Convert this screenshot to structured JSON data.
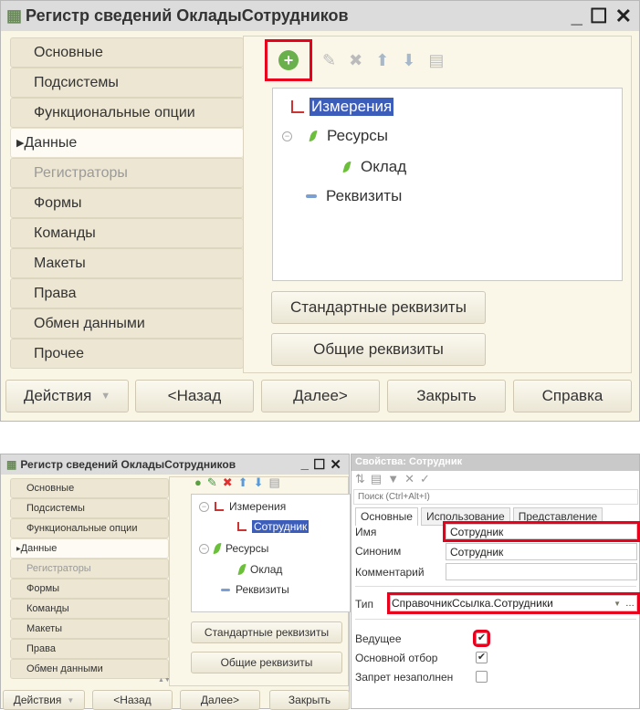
{
  "top_window": {
    "title": "Регистр сведений ОкладыСотрудников",
    "tabs": [
      "Основные",
      "Подсистемы",
      "Функциональные опции",
      "Данные",
      "Регистраторы",
      "Формы",
      "Команды",
      "Макеты",
      "Права",
      "Обмен данными",
      "Прочее"
    ],
    "active_tab": "Данные",
    "tree": {
      "dimensions": "Измерения",
      "resources": "Ресурсы",
      "resource_item": "Оклад",
      "attributes": "Реквизиты"
    },
    "std_attrs_button": "Стандартные реквизиты",
    "common_attrs_button": "Общие реквизиты",
    "footer": {
      "actions": "Действия",
      "back": "<Назад",
      "next": "Далее>",
      "close": "Закрыть",
      "help": "Справка"
    }
  },
  "bottom_window": {
    "title": "Регистр сведений ОкладыСотрудников",
    "tabs": [
      "Основные",
      "Подсистемы",
      "Функциональные опции",
      "Данные",
      "Регистраторы",
      "Формы",
      "Команды",
      "Макеты",
      "Права",
      "Обмен данными"
    ],
    "tree": {
      "dimensions": "Измерения",
      "dimension_item": "Сотрудник",
      "resources": "Ресурсы",
      "resource_item": "Оклад",
      "attributes": "Реквизиты"
    },
    "std_attrs_button": "Стандартные реквизиты",
    "common_attrs_button": "Общие реквизиты",
    "footer": {
      "actions": "Действия",
      "back": "<Назад",
      "next": "Далее>",
      "close": "Закрыть"
    }
  },
  "properties": {
    "title": "Свойства: Сотрудник",
    "search_placeholder": "Поиск (Ctrl+Alt+I)",
    "tabs": [
      "Основные",
      "Использование",
      "Представление"
    ],
    "name_label": "Имя",
    "name_value": "Сотрудник",
    "synonym_label": "Синоним",
    "synonym_value": "Сотрудник",
    "comment_label": "Комментарий",
    "comment_value": "",
    "type_label": "Тип",
    "type_value": "СправочникСсылка.Сотрудники",
    "master_label": "Ведущее",
    "master_checked": true,
    "main_filter_label": "Основной отбор",
    "main_filter_checked": true,
    "deny_empty_label": "Запрет незаполнен",
    "deny_empty_checked": false
  },
  "colors": {
    "highlight": "#e8001c",
    "selection": "#3d5dba"
  }
}
